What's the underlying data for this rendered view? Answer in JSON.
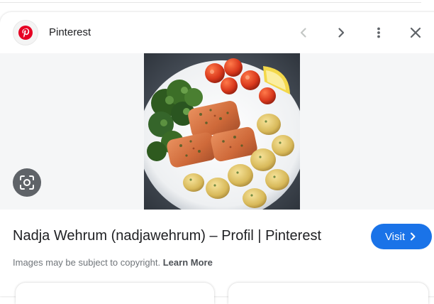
{
  "source": {
    "name": "Pinterest",
    "icon": "pinterest-logo-icon",
    "brand_color": "#e60023"
  },
  "header": {
    "back_icon": "chevron-left-icon",
    "forward_icon": "chevron-right-icon",
    "more_icon": "more-vert-icon",
    "close_icon": "close-icon"
  },
  "image": {
    "lens_icon": "lens-search-icon"
  },
  "result": {
    "title": "Nadja Wehrum (nadjawehrum) – Profil | Pinterest",
    "visit_label": "Visit",
    "visit_icon": "chevron-right-icon",
    "accent": "#1a73e8"
  },
  "copyright": {
    "text": "Images may be subject to copyright.",
    "link": "Learn More"
  }
}
